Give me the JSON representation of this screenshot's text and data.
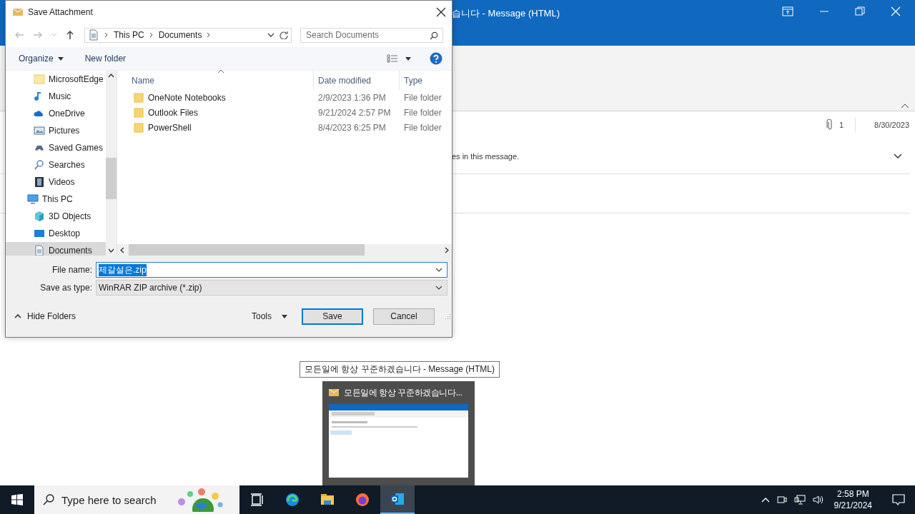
{
  "outlook": {
    "title": "습니다 - Message (HTML)",
    "attachment_count": "1",
    "date": "8/30/2023",
    "info_bar": "es in this message."
  },
  "dialog": {
    "title": "Save Attachment",
    "breadcrumb": [
      "This PC",
      "Documents"
    ],
    "search": {
      "placeholder": "Search Documents"
    },
    "toolbar": [
      "Organize",
      "New folder"
    ],
    "nav_tree": [
      {
        "children": [
          {
            "label": "MicrosoftEdge",
            "kind": "folder",
            "selected": false
          },
          {
            "label": "Music",
            "kind": "music",
            "selected": false
          },
          {
            "label": "OneDrive",
            "kind": "cloud",
            "selected": false
          },
          {
            "label": "Pictures",
            "kind": "pictures",
            "selected": false
          },
          {
            "label": "Saved Games",
            "kind": "games",
            "selected": false
          },
          {
            "label": "Searches",
            "kind": "search",
            "selected": false
          },
          {
            "label": "Videos",
            "kind": "video",
            "selected": false
          }
        ]
      },
      {
        "label": "This PC",
        "kind": "pc",
        "selected": false,
        "children": [
          {
            "label": "3D Objects",
            "kind": "cube",
            "selected": false
          },
          {
            "label": "Desktop",
            "kind": "desktop",
            "selected": false
          },
          {
            "label": "Documents",
            "kind": "documents",
            "selected": true
          }
        ]
      }
    ],
    "columns": [
      {
        "label": "Name",
        "sorted": true
      },
      {
        "label": "Date modified",
        "sorted": false
      },
      {
        "label": "Type",
        "sorted": false
      }
    ],
    "rows": [
      {
        "name": "OneNote Notebooks",
        "date": "2/9/2023 1:36 PM",
        "type": "File folder"
      },
      {
        "name": "Outlook Files",
        "date": "9/21/2024 2:57 PM",
        "type": "File folder"
      },
      {
        "name": "PowerShell",
        "date": "8/4/2023 6:25 PM",
        "type": "File folder"
      }
    ],
    "file_name": {
      "label": "File name:",
      "value": "제갈설은.zip",
      "text_selected": true
    },
    "save_type": {
      "label": "Save as type:",
      "value": "WinRAR ZIP archive (*.zip)"
    },
    "hide_folders": "Hide Folders",
    "tools": "Tools",
    "buttons": [
      {
        "label": "Save",
        "default": true
      },
      {
        "label": "Cancel",
        "default": false
      }
    ]
  },
  "tooltip": "모든일에 항상 꾸준하겠습니다 - Message (HTML)",
  "preview": {
    "title": "모든일에 항상 꾸준하겠습니다..."
  },
  "taskbar": {
    "search": {
      "placeholder": "Type here to search"
    },
    "apps": [
      {
        "kind": "taskview",
        "selected": false
      },
      {
        "kind": "edge",
        "selected": false
      },
      {
        "kind": "explorer",
        "selected": false
      },
      {
        "kind": "firefox",
        "selected": false
      },
      {
        "kind": "outlook",
        "selected": true
      }
    ],
    "time": "2:58 PM",
    "date": "9/21/2024"
  }
}
